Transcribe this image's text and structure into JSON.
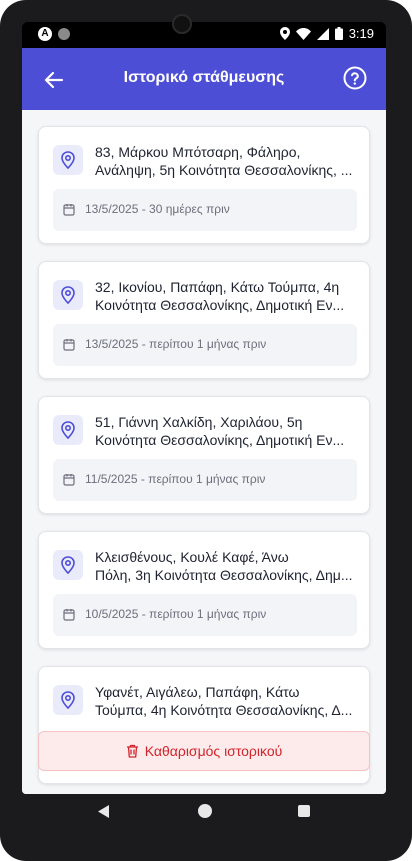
{
  "status": {
    "time": "3:19"
  },
  "header": {
    "title": "Ιστορικό στάθμευσης"
  },
  "history": [
    {
      "line1": "83, Μάρκου Μπότσαρη, Φάληρο,",
      "line2": "Ανάληψη, 5η Κοινότητα Θεσσαλονίκης, ...",
      "date": "13/5/2025 - 30 ημέρες πριν"
    },
    {
      "line1": "32, Ικονίου, Παπάφη, Κάτω Τούμπα, 4η",
      "line2": "Κοινότητα Θεσσαλονίκης, Δημοτική Εν...",
      "date": "13/5/2025 - περίπου 1 μήνας πριν"
    },
    {
      "line1": "51, Γιάννη Χαλκίδη, Χαριλάου, 5η",
      "line2": "Κοινότητα Θεσσαλονίκης, Δημοτική Εν...",
      "date": "11/5/2025 - περίπου 1 μήνας πριν"
    },
    {
      "line1": "Κλεισθένους, Κουλέ Καφέ, Άνω",
      "line2": "Πόλη, 3η Κοινότητα Θεσσαλονίκης, Δημ...",
      "date": "10/5/2025 - περίπου 1 μήνας πριν"
    },
    {
      "line1": "Υφανέτ, Αιγάλεω, Παπάφη, Κάτω",
      "line2": "Τούμπα, 4η Κοινότητα Θεσσαλονίκης, Δ...",
      "date": ""
    }
  ],
  "actions": {
    "clear_label": "Καθαρισμός ιστορικού"
  },
  "colors": {
    "primary": "#4d4ed6",
    "danger": "#d0242c",
    "danger_bg": "#fdeaea"
  }
}
